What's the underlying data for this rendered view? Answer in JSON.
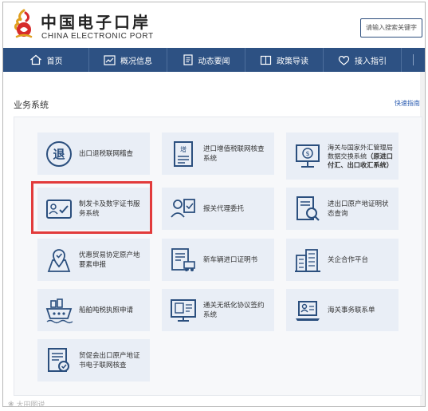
{
  "header": {
    "logo_cn": "中国电子口岸",
    "logo_en": "CHINA ELECTRONIC PORT",
    "search_placeholder": "请输入搜索关键字"
  },
  "nav": [
    {
      "label": "首页",
      "icon": "home-icon"
    },
    {
      "label": "概况信息",
      "icon": "chart-icon"
    },
    {
      "label": "动态要闻",
      "icon": "news-icon"
    },
    {
      "label": "政策导读",
      "icon": "book-icon"
    },
    {
      "label": "接入指引",
      "icon": "heart-icon"
    },
    {
      "label": "",
      "icon": ""
    }
  ],
  "section": {
    "title": "业务系统",
    "quick_guide": "快速指南"
  },
  "tiles": [
    {
      "label": "出口退税联网稽查",
      "icon": "tax-refund-icon"
    },
    {
      "label": "进口增值税联网核查系统",
      "icon": "vat-document-icon"
    },
    {
      "label": "海关与国家外汇管理局数据交换系统",
      "label_bold": "（原进口付汇、出口收汇系统）",
      "icon": "exchange-monitor-icon"
    },
    {
      "label": "制发卡及数字证书服务系统",
      "icon": "id-card-icon"
    },
    {
      "label": "报关代理委托",
      "icon": "agent-delegate-icon"
    },
    {
      "label": "进出口原产地证明状态查询",
      "icon": "origin-search-icon"
    },
    {
      "label": "优惠贸易协定原产地要素申报",
      "icon": "map-pin-icon"
    },
    {
      "label": "新车辆进口证明书",
      "icon": "vehicle-certificate-icon"
    },
    {
      "label": "关企合作平台",
      "icon": "building-icon"
    },
    {
      "label": "船舶吨税执照申请",
      "icon": "ship-icon"
    },
    {
      "label": "通关无纸化协议签约系统",
      "icon": "paperless-monitor-icon"
    },
    {
      "label": "海关事务联系单",
      "icon": "laptop-contact-icon"
    },
    {
      "label": "贸促会出口原产地证书电子联网核查",
      "icon": "certificate-check-icon"
    }
  ],
  "watermark": "大田图说"
}
